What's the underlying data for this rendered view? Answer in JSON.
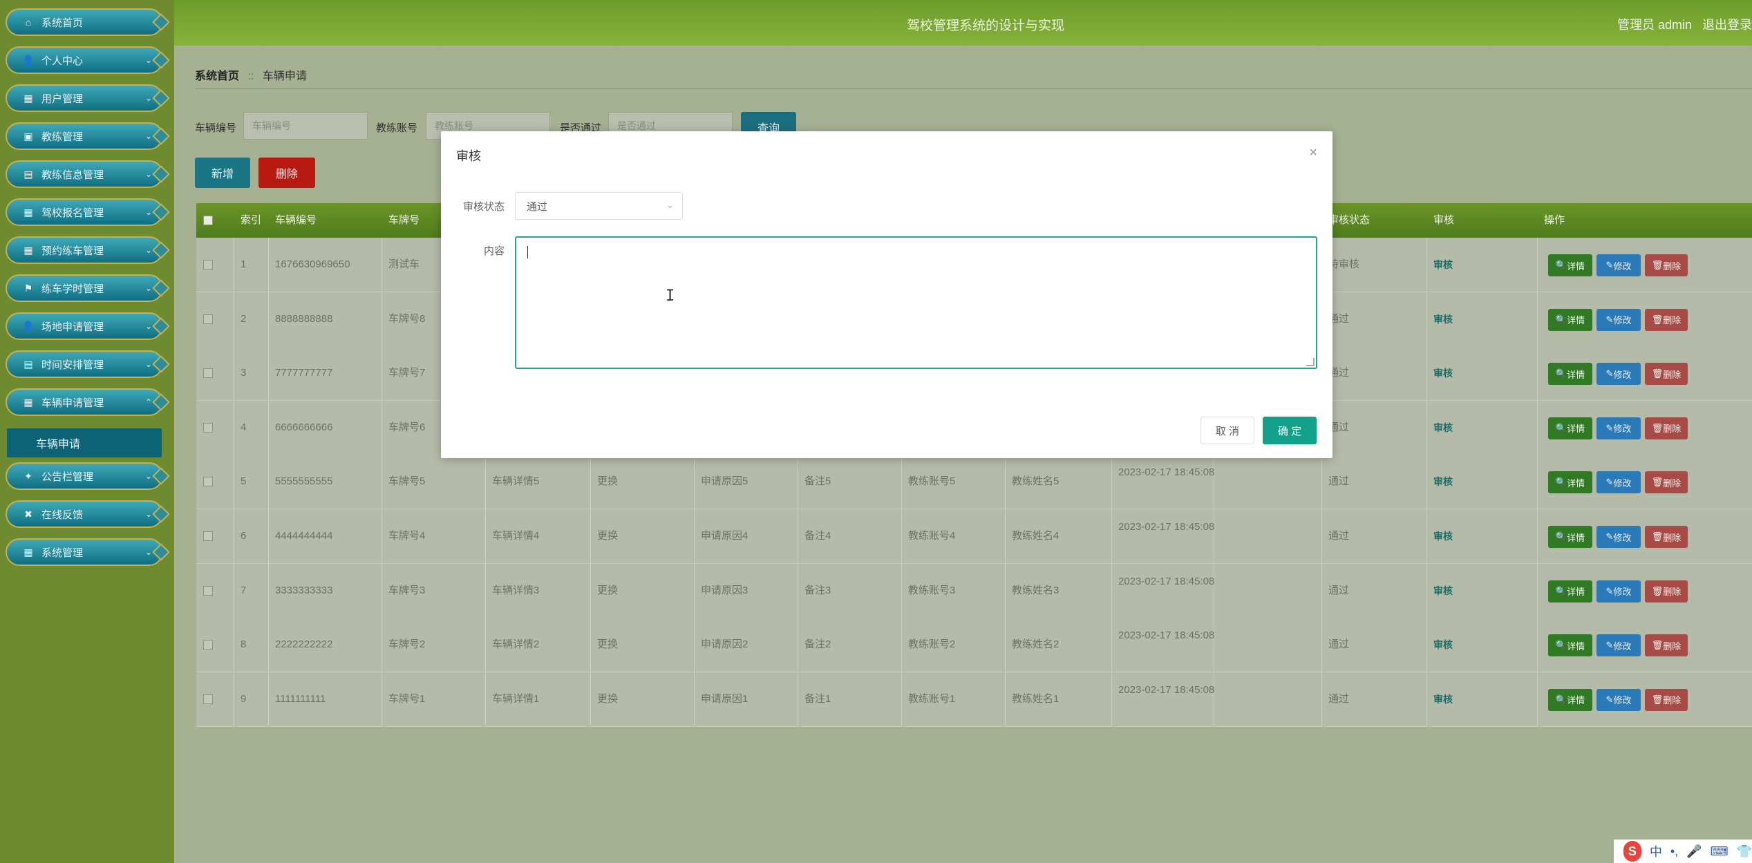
{
  "header": {
    "title": "驾校管理系统的设计与实现",
    "admin": "管理员 admin",
    "logout": "退出登录"
  },
  "sidebar": {
    "items": [
      {
        "label": "系统首页",
        "icon": "home-icon",
        "glyph": "⌂",
        "arrow": ""
      },
      {
        "label": "个人中心",
        "icon": "user-icon",
        "glyph": "👤",
        "arrow": "⌄"
      },
      {
        "label": "用户管理",
        "icon": "grid-icon",
        "glyph": "▦",
        "arrow": "⌄"
      },
      {
        "label": "教练管理",
        "icon": "briefcase-icon",
        "glyph": "▣",
        "arrow": "⌄"
      },
      {
        "label": "教练信息管理",
        "icon": "document-icon",
        "glyph": "▤",
        "arrow": "⌄"
      },
      {
        "label": "驾校报名管理",
        "icon": "grid-icon",
        "glyph": "▦",
        "arrow": "⌄"
      },
      {
        "label": "预约练车管理",
        "icon": "grid-icon",
        "glyph": "▦",
        "arrow": "⌄"
      },
      {
        "label": "练车学时管理",
        "icon": "flag-icon",
        "glyph": "⚑",
        "arrow": "⌄"
      },
      {
        "label": "场地申请管理",
        "icon": "user-icon",
        "glyph": "👤",
        "arrow": "⌄"
      },
      {
        "label": "时间安排管理",
        "icon": "document-icon",
        "glyph": "▤",
        "arrow": "⌄"
      },
      {
        "label": "车辆申请管理",
        "icon": "grid-icon",
        "glyph": "▦",
        "arrow": "⌃"
      },
      {
        "label": "公告栏管理",
        "icon": "bulb-icon",
        "glyph": "✦",
        "arrow": "⌄"
      },
      {
        "label": "在线反馈",
        "icon": "feedback-icon",
        "glyph": "✖",
        "arrow": "⌄"
      },
      {
        "label": "系统管理",
        "icon": "grid-icon",
        "glyph": "▦",
        "arrow": "⌄"
      }
    ],
    "submenu": "车辆申请"
  },
  "breadcrumb": {
    "home": "系统首页",
    "sep": "::",
    "current": "车辆申请"
  },
  "search": {
    "vehicle_no_label": "车辆编号",
    "vehicle_no_placeholder": "车辆编号",
    "coach_account_label": "教练账号",
    "coach_account_placeholder": "教练账号",
    "approved_label": "是否通过",
    "approved_placeholder": "是否通过",
    "query_button": "查询"
  },
  "toolbar": {
    "add": "新增",
    "delete": "删除"
  },
  "table": {
    "headers": [
      "索引",
      "车辆编号",
      "车牌号",
      "",
      "",
      "",
      "",
      "",
      "",
      "",
      "",
      "审核状态",
      "审核",
      "操作"
    ],
    "rows": [
      {
        "idx": "1",
        "vno": "1676630969650",
        "plate": "测试车",
        "detail": "",
        "type": "",
        "reason": "",
        "remark": "",
        "acc": "",
        "name": "",
        "time": "",
        "reply": "",
        "status": "待审核"
      },
      {
        "idx": "2",
        "vno": "8888888888",
        "plate": "车牌号8",
        "detail": "",
        "type": "",
        "reason": "",
        "remark": "",
        "acc": "",
        "name": "",
        "time": "",
        "reply": "",
        "status": "通过"
      },
      {
        "idx": "3",
        "vno": "7777777777",
        "plate": "车牌号7",
        "detail": "",
        "type": "",
        "reason": "",
        "remark": "",
        "acc": "",
        "name": "",
        "time": "",
        "reply": "",
        "status": "通过"
      },
      {
        "idx": "4",
        "vno": "6666666666",
        "plate": "车牌号6",
        "detail": "",
        "type": "",
        "reason": "",
        "remark": "",
        "acc": "",
        "name": "",
        "time": "",
        "reply": "",
        "status": "通过"
      },
      {
        "idx": "5",
        "vno": "5555555555",
        "plate": "车牌号5",
        "detail": "车辆详情5",
        "type": "更换",
        "reason": "申请原因5",
        "remark": "备注5",
        "acc": "教练账号5",
        "name": "教练姓名5",
        "time": "2023-02-17 18:45:08",
        "reply": "",
        "status": "通过"
      },
      {
        "idx": "6",
        "vno": "4444444444",
        "plate": "车牌号4",
        "detail": "车辆详情4",
        "type": "更换",
        "reason": "申请原因4",
        "remark": "备注4",
        "acc": "教练账号4",
        "name": "教练姓名4",
        "time": "2023-02-17 18:45:08",
        "reply": "",
        "status": "通过"
      },
      {
        "idx": "7",
        "vno": "3333333333",
        "plate": "车牌号3",
        "detail": "车辆详情3",
        "type": "更换",
        "reason": "申请原因3",
        "remark": "备注3",
        "acc": "教练账号3",
        "name": "教练姓名3",
        "time": "2023-02-17 18:45:08",
        "reply": "",
        "status": "通过"
      },
      {
        "idx": "8",
        "vno": "2222222222",
        "plate": "车牌号2",
        "detail": "车辆详情2",
        "type": "更换",
        "reason": "申请原因2",
        "remark": "备注2",
        "acc": "教练账号2",
        "name": "教练姓名2",
        "time": "2023-02-17 18:45:08",
        "reply": "",
        "status": "通过"
      },
      {
        "idx": "9",
        "vno": "1111111111",
        "plate": "车牌号1",
        "detail": "车辆详情1",
        "type": "更换",
        "reason": "申请原因1",
        "remark": "备注1",
        "acc": "教练账号1",
        "name": "教练姓名1",
        "time": "2023-02-17 18:45:08",
        "reply": "",
        "status": "通过"
      }
    ],
    "review_link": "审核",
    "ops": {
      "detail": "详情",
      "edit": "修改",
      "delete": "删除"
    }
  },
  "modal": {
    "title": "审核",
    "close": "×",
    "status_label": "审核状态",
    "status_value": "通过",
    "content_label": "内容",
    "content_value": "",
    "cancel": "取 消",
    "ok": "确 定"
  },
  "tray": {
    "logo": "S",
    "ime": "中",
    "punct": "•,"
  },
  "colors": {
    "accent": "#12a08a",
    "header_green": "#6c9c2a",
    "sidebar_teal": "#0f6f82"
  }
}
